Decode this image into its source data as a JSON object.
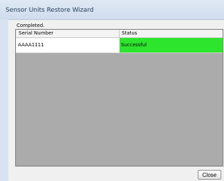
{
  "window": {
    "title": "Sensor Units Restore Wizard"
  },
  "status": {
    "label": "Completed."
  },
  "table": {
    "columns": [
      "Serial Number",
      "Status"
    ],
    "rows": [
      {
        "serial_number": "AAAA1111",
        "status": "Successful",
        "status_color": "#2ee52e"
      }
    ]
  },
  "footer": {
    "close_label": "Close"
  }
}
